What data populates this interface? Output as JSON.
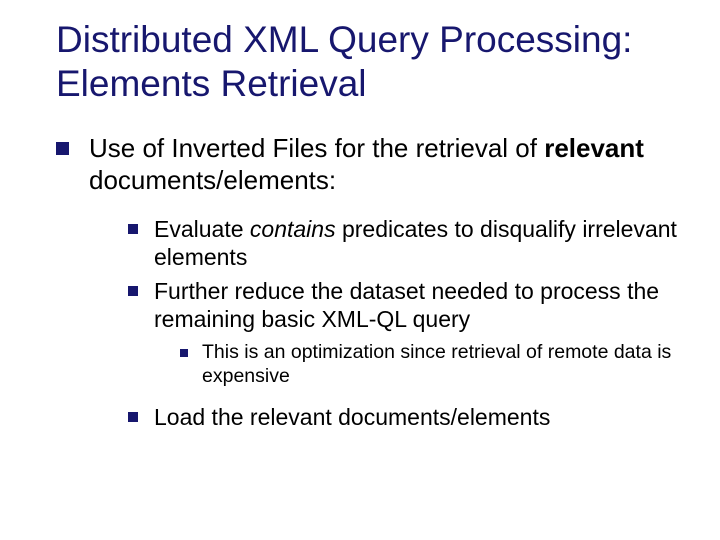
{
  "title": "Distributed XML Query Processing: Elements Retrieval",
  "lvl1": {
    "pre": "Use of Inverted Files for the retrieval of ",
    "bold": "relevant",
    "post": " documents/elements:"
  },
  "lvl2a": {
    "pre": "Evaluate ",
    "italic": "contains",
    "post": " predicates to disqualify irrelevant elements"
  },
  "lvl2b": "Further reduce the dataset needed to process the remaining basic XML-QL query",
  "lvl3a": "This is an optimization since retrieval of remote data is expensive",
  "lvl2c": "Load the relevant documents/elements"
}
